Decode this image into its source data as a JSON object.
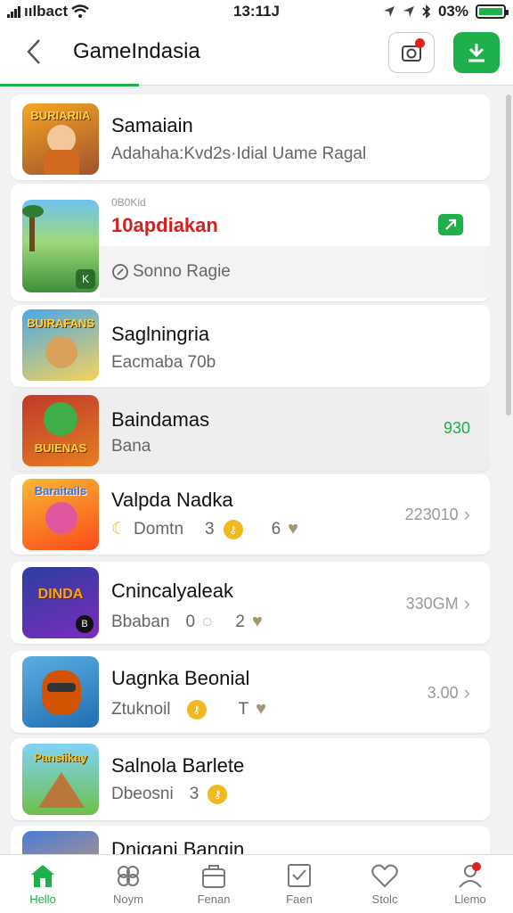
{
  "status": {
    "carrier": "ıılbact",
    "time": "13:11J",
    "battery": "03%"
  },
  "header": {
    "title": "GameIndasia"
  },
  "items": [
    {
      "name": "Samaiain",
      "sub": "Adahaha:Kvd2s·Idial Uame Ragal",
      "thumb_text": "BURIARIIA"
    },
    {
      "name_top": "0B0Kid",
      "name": "10apdiakan",
      "sub": "Sonno Ragie",
      "meta": ""
    },
    {
      "name": "Saglningria",
      "sub": "Eacmaba  70b",
      "thumb_text": "BUIRAFANS"
    },
    {
      "name": "Baindamas",
      "sub": "Bana",
      "meta": "930",
      "thumb_text": "BUIENAS"
    },
    {
      "name": "Valpda Nadka",
      "sub": "Domtn",
      "num1": "3",
      "num2": "6",
      "meta": "223010",
      "thumb_text": "Baraitails"
    },
    {
      "name": "Cnincalyaleak",
      "sub": "Bbaban",
      "num1": "0",
      "num2": "2",
      "meta": "330GM",
      "thumb_text": "DINDA"
    },
    {
      "name": "Uagnka Beonial",
      "sub": "Ztuknoil",
      "num1": "",
      "num2": "T",
      "meta": "3.00",
      "thumb_text": ""
    },
    {
      "name": "Salnola Barlete",
      "sub": "Dbeosni",
      "num1": "3",
      "num2": "",
      "meta": "",
      "thumb_text": "Pansiikay"
    },
    {
      "name": "Dnigani Bangin",
      "sub": "",
      "meta": ""
    }
  ],
  "nav": [
    {
      "label": "Hello",
      "icon": "home-icon"
    },
    {
      "label": "Noym",
      "icon": "clover-icon"
    },
    {
      "label": "Fenan",
      "icon": "bag-icon"
    },
    {
      "label": "Faen",
      "icon": "checkbox-icon"
    },
    {
      "label": "Stolc",
      "icon": "heart-icon"
    },
    {
      "label": "Llemo",
      "icon": "profile-icon"
    }
  ],
  "colors": {
    "accent": "#1db04b",
    "alert": "#e02020",
    "danger_text": "#d42020"
  }
}
